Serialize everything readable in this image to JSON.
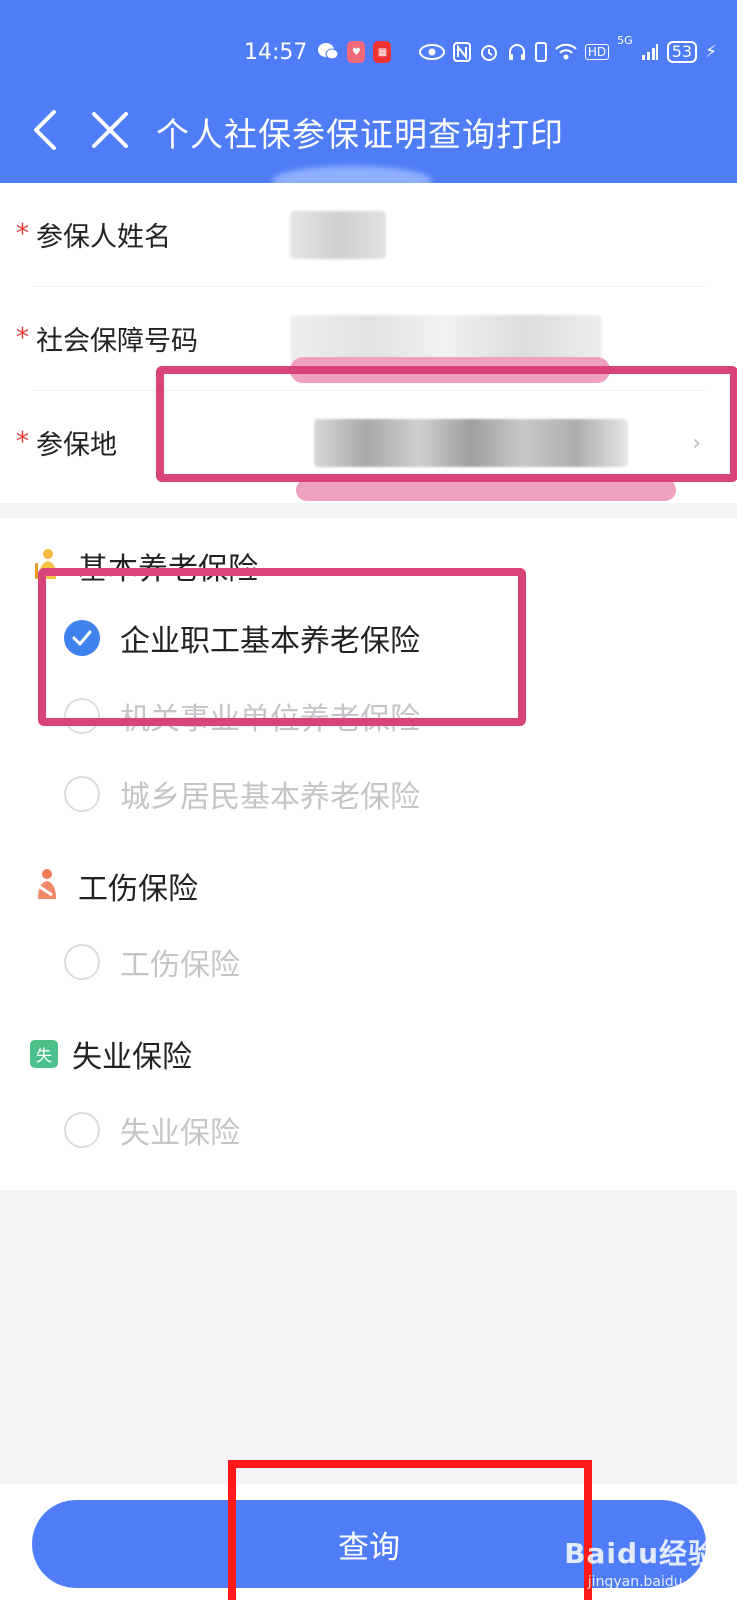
{
  "status_bar": {
    "time": "14:57",
    "network_label": "HD",
    "network_type": "5G",
    "battery": "53"
  },
  "header": {
    "title": "个人社保参保证明查询打印"
  },
  "form": {
    "fields": [
      {
        "label": "参保人姓名",
        "required": "*"
      },
      {
        "label": "社会保障号码",
        "required": "*"
      },
      {
        "label": "参保地",
        "required": "*"
      }
    ]
  },
  "sections": [
    {
      "title": "基本养老保险",
      "icon": "elderly-person-icon",
      "options": [
        {
          "label": "企业职工基本养老保险",
          "selected": true
        },
        {
          "label": "机关事业单位养老保险",
          "selected": false
        },
        {
          "label": "城乡居民基本养老保险",
          "selected": false
        }
      ]
    },
    {
      "title": "工伤保险",
      "icon": "injured-person-icon",
      "options": [
        {
          "label": "工伤保险",
          "selected": false
        }
      ]
    },
    {
      "title": "失业保险",
      "icon": "unemployment-badge-icon",
      "badge_text": "失",
      "options": [
        {
          "label": "失业保险",
          "selected": false
        }
      ]
    }
  ],
  "query_button": "查询",
  "watermark": {
    "main": "Baidu经验",
    "sub": "jingyan.baidu.com"
  },
  "colors": {
    "primary": "#4f7cf7",
    "checked": "#3f82ee",
    "required": "#e63a3a",
    "annotation_pink": "#d84479",
    "annotation_red": "#ff1a1a"
  }
}
